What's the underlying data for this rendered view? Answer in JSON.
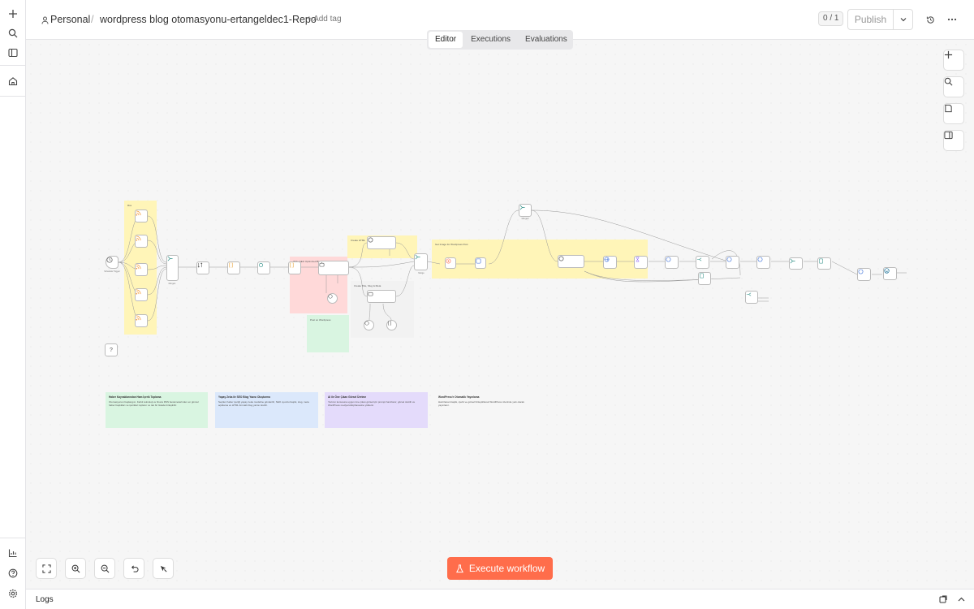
{
  "breadcrumb": {
    "project": "Personal",
    "separator": "/",
    "workflow_name": "wordpress blog otomasyonu-ertangeldec1-Repo",
    "add_tag": "+ Add tag"
  },
  "header": {
    "version_counter": "0 / 1",
    "publish_label": "Publish"
  },
  "tabs": [
    {
      "label": "Editor",
      "active": true
    },
    {
      "label": "Executions",
      "active": false
    },
    {
      "label": "Evaluations",
      "active": false
    }
  ],
  "execute_button": "Execute workflow",
  "logs_label": "Logs",
  "colors": {
    "accent": "#ff6d4b",
    "sticky_yellow": "#fff5b8",
    "sticky_red": "#ffd9d9",
    "sticky_green": "#d9f5e1",
    "sticky_blue": "#dbe8fb",
    "sticky_purple": "#e4dbfb"
  },
  "canvas": {
    "group_labels": {
      "rss": "Rss",
      "write_seo": "Write SEO Optimized Blog Post",
      "create_html": "Create HTML",
      "create_title": "Create Title, Slug & Meta",
      "get_image": "Get Image for Wordpress Post",
      "post_wordpress": "Post on Wordpress"
    },
    "node_labels": {
      "schedule_trigger": "Schedule Trigger",
      "merge1": "Merge1",
      "merge": "Merge",
      "merge2": "Merge2",
      "get_image_size": "Get Image Size"
    },
    "stickies": [
      {
        "title": "Haber Kaynaklarından Ham İçerik Toplama",
        "body": "Otomasyonun başlangıcı. Farklı teknoloji ve finans RSS beslemelerinden en güncel haber başlıkları ve içerikleri toplanır ve tek bir listede birleştirilir."
      },
      {
        "title": "Yapay Zeka ile SEO Blog Yazısı Oluşturma",
        "body": "Seçilen haber içeriği yapay zeka modeline gönderilir, SEO uyumlu başlık, slug, meta açıklama ve HTML formatlı blog yazısı üretilir."
      },
      {
        "title": "AI ile Öne Çıkan Görsel Üretme",
        "body": "Yazının konusuna uygun öne çıkan görsel için prompt hazırlanır, görsel üretilir ve WordPress medya kütüphanesine yüklenir."
      },
      {
        "title": "WordPress'e Otomatik Yayınlama",
        "body": "Hazırlanan başlık, içerik ve görsel birleştirilerek WordPress üzerinde yazı olarak yayınlanır."
      }
    ]
  }
}
